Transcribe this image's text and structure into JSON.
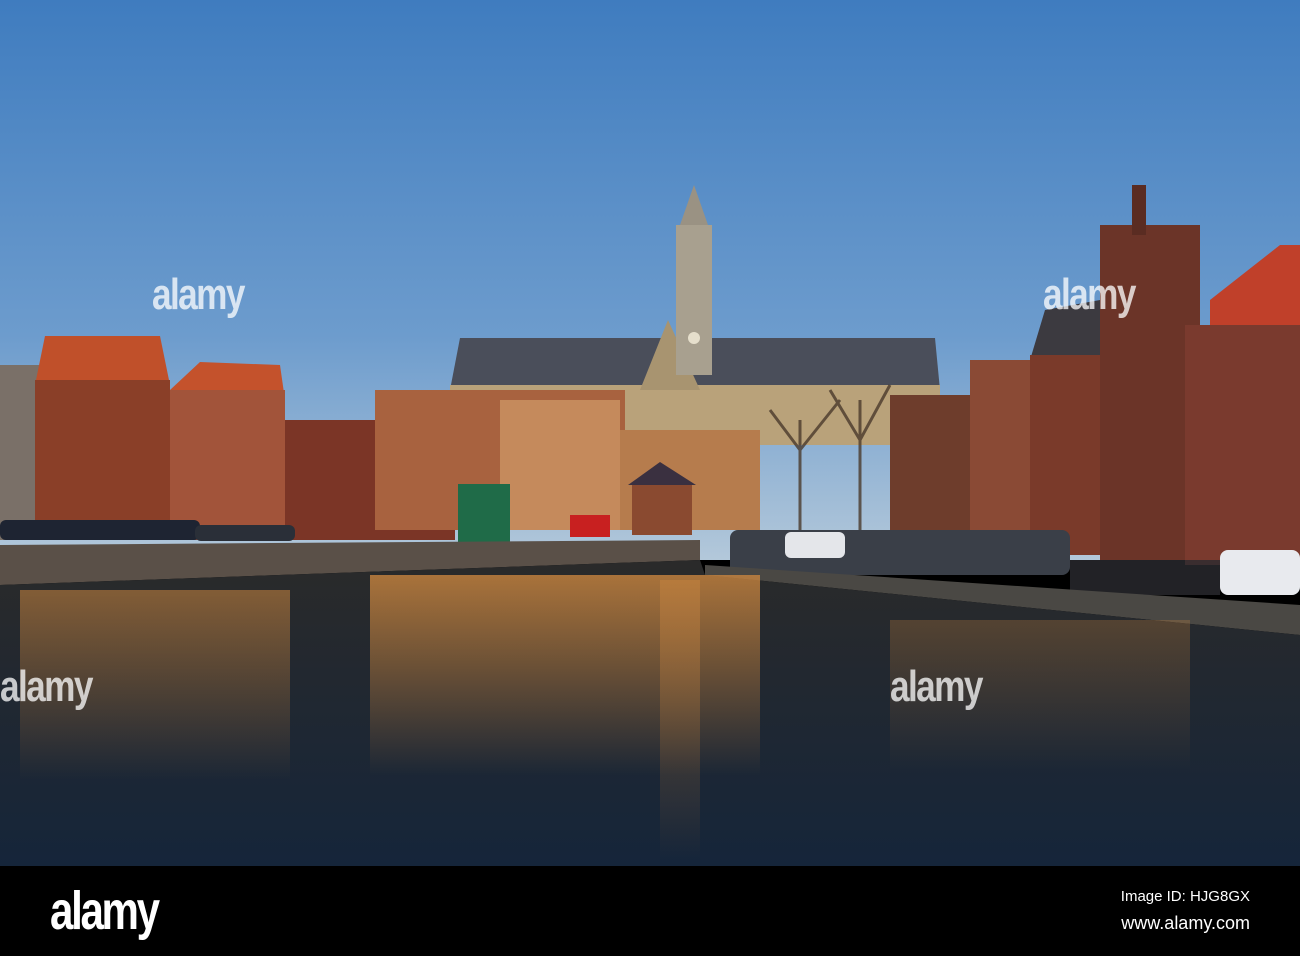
{
  "watermark": {
    "text": "alamy"
  },
  "footer": {
    "logo": "alamy",
    "image_id": "Image ID: HJG8GX",
    "website": "www.alamy.com"
  },
  "colors": {
    "sky_top": "#3d7cc0",
    "sky_bottom": "#a9c3dc",
    "water": "#1a2330",
    "brick": "#8a3f28",
    "footer": "#000000"
  }
}
